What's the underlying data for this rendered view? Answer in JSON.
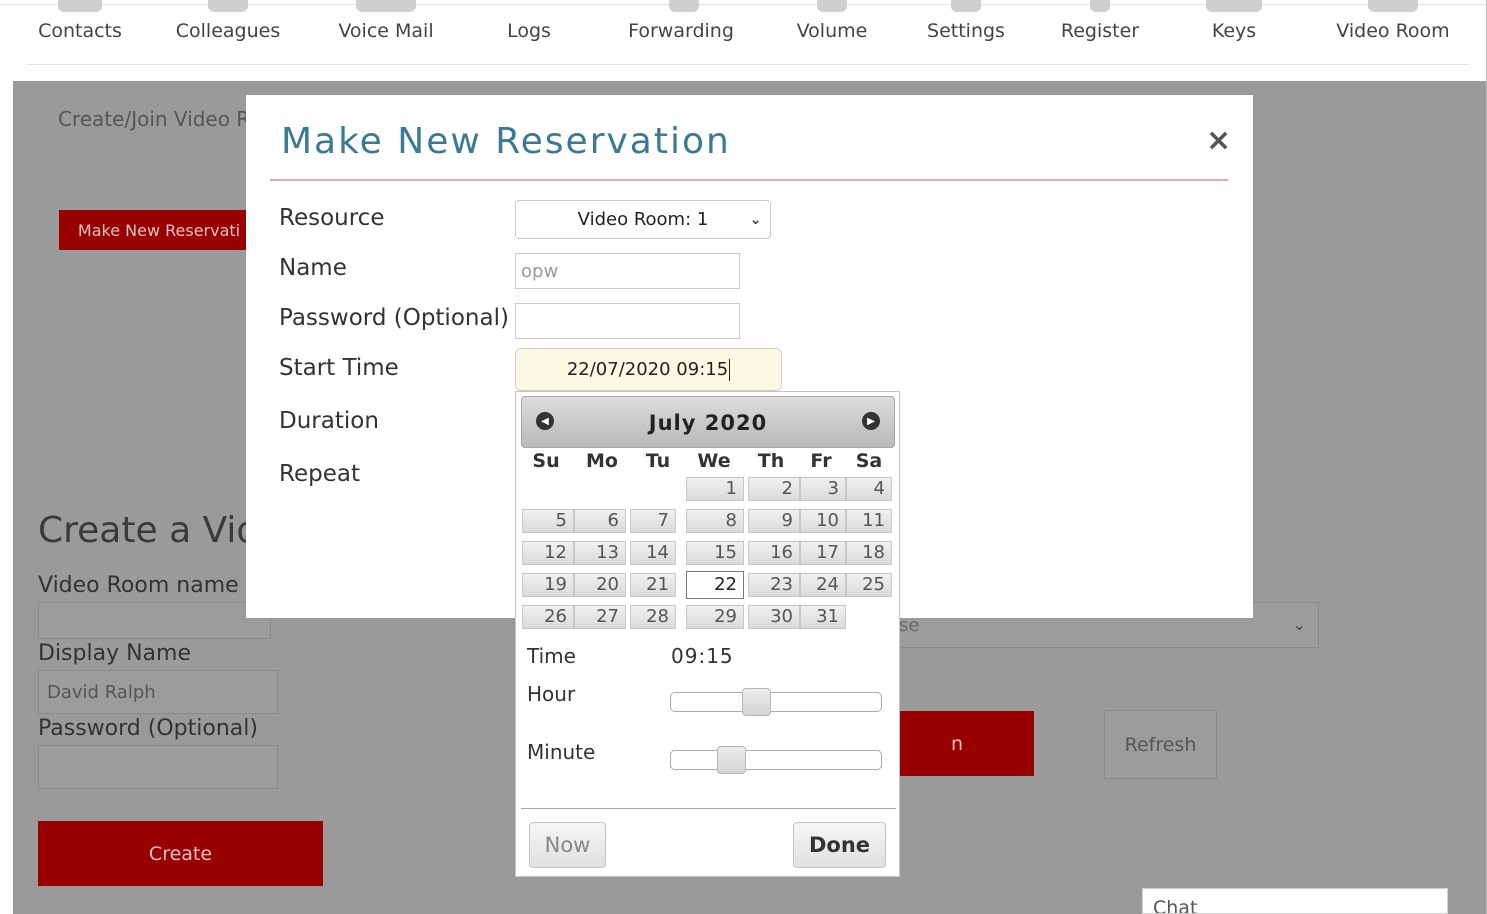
{
  "nav": {
    "items": [
      "Contacts",
      "Colleagues",
      "Voice Mail",
      "Logs",
      "Forwarding",
      "Volume",
      "Settings",
      "Register",
      "Keys",
      "Video Room"
    ]
  },
  "background": {
    "create_join_label": "Create/Join Video Ro",
    "make_new_button": "Make New Reservati",
    "create_video_heading": "Create a Vide",
    "video_room_name_label": "Video Room name",
    "display_name_label": "Display Name",
    "display_name_value": "David Ralph",
    "password_label": "Password (Optional)",
    "create_button": "Create",
    "select_partial": "se",
    "red_button_partial": "n",
    "refresh_button": "Refresh",
    "chat_label": "Chat"
  },
  "modal": {
    "title": "Make New Reservation",
    "close": "×",
    "labels": {
      "resource": "Resource",
      "name": "Name",
      "password": "Password (Optional)",
      "start_time": "Start Time",
      "duration": "Duration",
      "repeat": "Repeat"
    },
    "resource_value": "Video Room: 1",
    "name_placeholder": "opw",
    "start_time_value": "22/07/2020 09:15"
  },
  "datepicker": {
    "month_label": "July 2020",
    "weekdays": [
      "Su",
      "Mo",
      "Tu",
      "We",
      "Th",
      "Fr",
      "Sa"
    ],
    "selected_day": 22,
    "time_label": "Time",
    "time_value": "09:15",
    "hour_label": "Hour",
    "minute_label": "Minute",
    "hour_fraction": 0.39,
    "minute_fraction": 0.25,
    "now_button": "Now",
    "done_button": "Done"
  }
}
